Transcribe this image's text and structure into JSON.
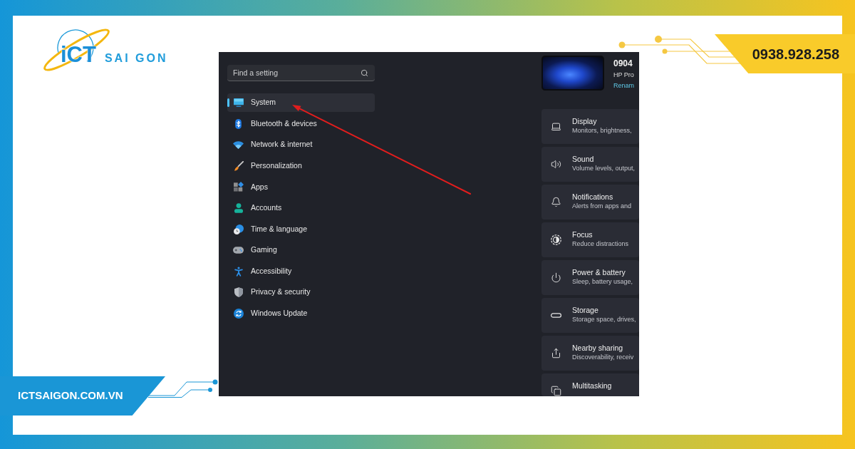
{
  "brand": {
    "logo_mark": "iCT",
    "logo_text": "SAI GON"
  },
  "phone_banner": {
    "text": "0938.928.258"
  },
  "settings": {
    "search": {
      "placeholder": "Find a setting"
    },
    "nav_items": [
      {
        "label": "System",
        "selected": true
      },
      {
        "label": "Bluetooth & devices",
        "selected": false
      },
      {
        "label": "Network & internet",
        "selected": false
      },
      {
        "label": "Personalization",
        "selected": false
      },
      {
        "label": "Apps",
        "selected": false
      },
      {
        "label": "Accounts",
        "selected": false
      },
      {
        "label": "Time & language",
        "selected": false
      },
      {
        "label": "Gaming",
        "selected": false
      },
      {
        "label": "Accessibility",
        "selected": false
      },
      {
        "label": "Privacy & security",
        "selected": false
      },
      {
        "label": "Windows Update",
        "selected": false
      }
    ],
    "device": {
      "name": "0904",
      "model": "HP Pro",
      "rename_link": "Renam"
    },
    "cards": [
      {
        "title": "Display",
        "subtitle": "Monitors, brightness,"
      },
      {
        "title": "Sound",
        "subtitle": "Volume levels, output,"
      },
      {
        "title": "Notifications",
        "subtitle": "Alerts from apps and"
      },
      {
        "title": "Focus",
        "subtitle": "Reduce distractions"
      },
      {
        "title": "Power & battery",
        "subtitle": "Sleep, battery usage,"
      },
      {
        "title": "Storage",
        "subtitle": "Storage space, drives,"
      },
      {
        "title": "Nearby sharing",
        "subtitle": "Discoverability, receiv"
      },
      {
        "title": "Multitasking"
      }
    ]
  },
  "website_banner": {
    "text": "ICTSAIGON.COM.VN"
  }
}
